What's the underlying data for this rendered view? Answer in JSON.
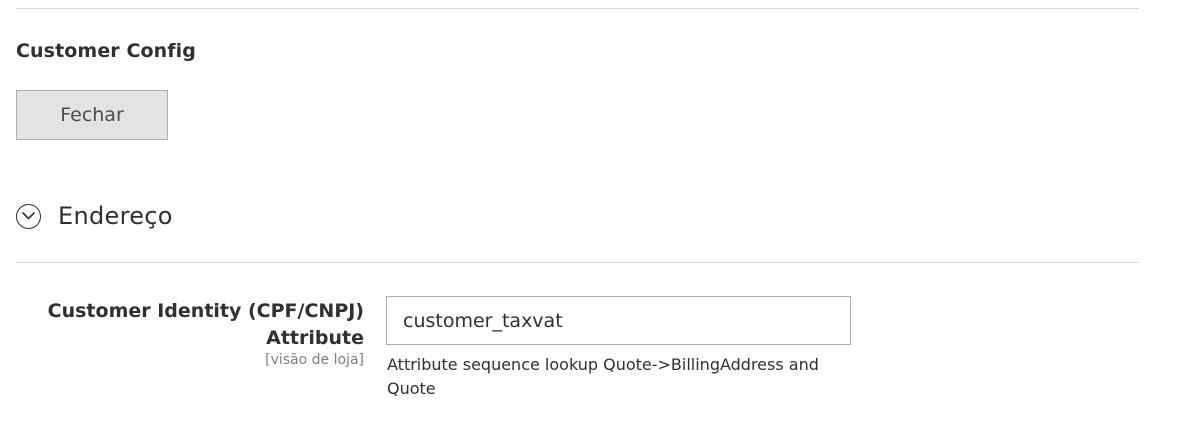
{
  "section": {
    "title": "Customer Config",
    "close_label": "Fechar"
  },
  "group": {
    "title": "Endereço",
    "icon": "chevron-down-icon"
  },
  "field": {
    "label_line1": "Customer Identity (CPF/CNPJ)",
    "label_line2": "Attribute",
    "scope": "[visão de loja]",
    "value": "customer_taxvat",
    "note": "Attribute sequence lookup Quote->BillingAddress and Quote"
  }
}
